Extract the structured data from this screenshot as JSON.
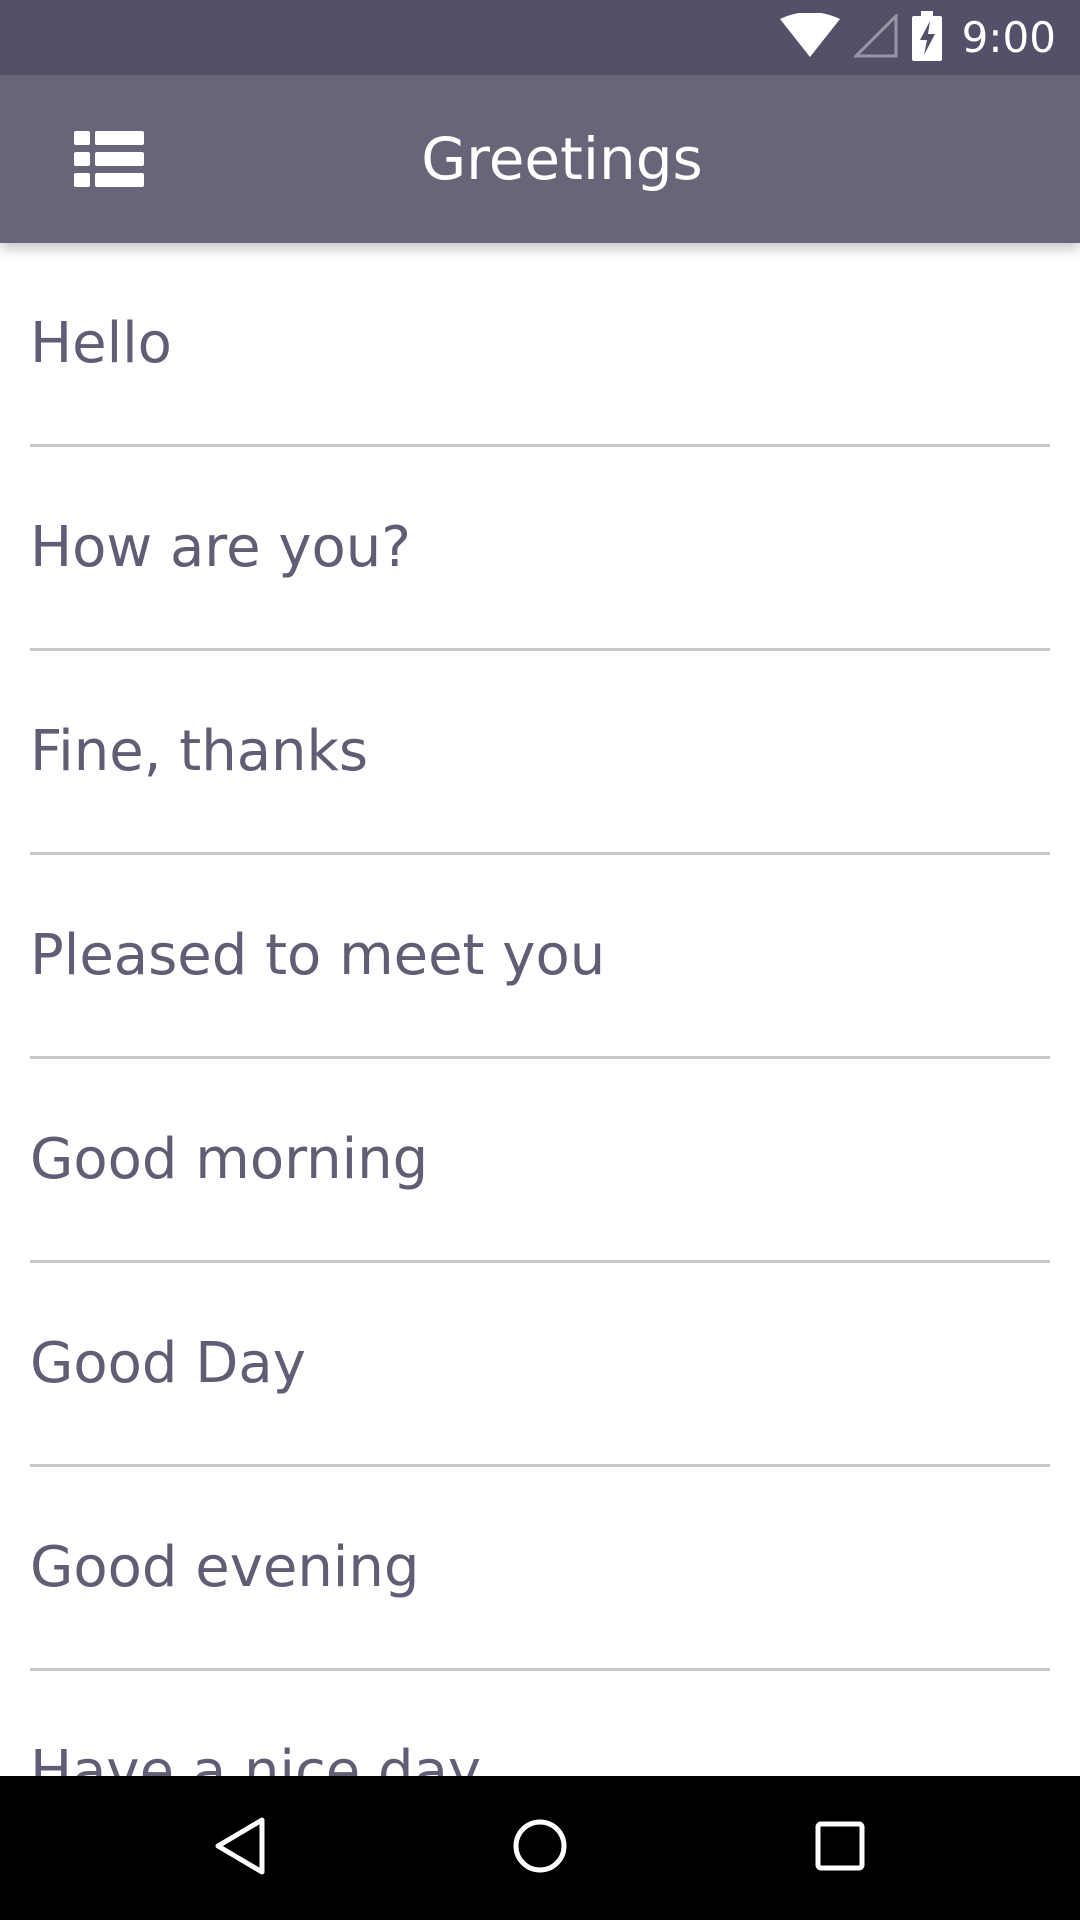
{
  "status_bar": {
    "time": "9:00",
    "icons": [
      "wifi-icon",
      "cell-signal-icon",
      "battery-charging-icon"
    ]
  },
  "app_bar": {
    "title": "Greetings",
    "menu_icon": "list-view-icon"
  },
  "list": {
    "items": [
      {
        "label": "Hello"
      },
      {
        "label": "How are you?"
      },
      {
        "label": "Fine, thanks"
      },
      {
        "label": "Pleased to meet you"
      },
      {
        "label": "Good morning"
      },
      {
        "label": "Good Day"
      },
      {
        "label": "Good evening"
      },
      {
        "label": "Have a nice day"
      }
    ]
  },
  "nav_bar": {
    "buttons": [
      "back-icon",
      "home-icon",
      "recents-icon"
    ]
  },
  "colors": {
    "status_bar": "#555069",
    "app_bar": "#6a6479",
    "item_text": "#615d74",
    "divider": "#c8c8c8"
  }
}
